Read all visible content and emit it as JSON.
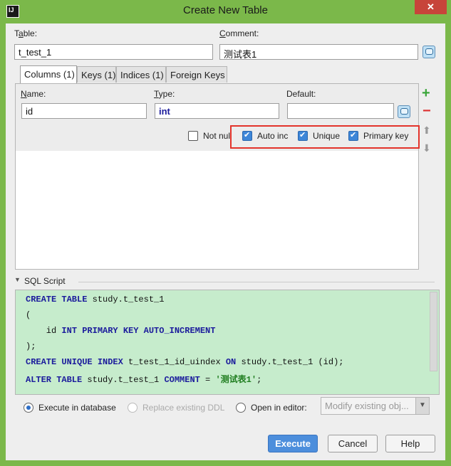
{
  "window": {
    "title": "Create New Table",
    "close": "✕"
  },
  "form": {
    "table_label": "Table:",
    "table_value": "t_test_1",
    "comment_label": "Comment:",
    "comment_value": "测试表1"
  },
  "tabs": [
    "Columns (1)",
    "Keys (1)",
    "Indices (1)",
    "Foreign Keys"
  ],
  "column": {
    "name_label": "Name:",
    "name_value": "id",
    "type_label": "Type:",
    "type_value": "int",
    "default_label": "Default:",
    "default_value": "",
    "not_null_label": "Not null",
    "not_null_checked": false,
    "auto_inc_label": "Auto inc",
    "auto_inc_checked": true,
    "unique_label": "Unique",
    "unique_checked": true,
    "primary_key_label": "Primary key",
    "primary_key_checked": true
  },
  "side_buttons": {
    "add": "+",
    "remove": "−",
    "up": "⬆",
    "down": "⬇"
  },
  "sql": {
    "header": "SQL Script",
    "lines": [
      "CREATE TABLE study.t_test_1",
      "(",
      "    id INT PRIMARY KEY AUTO_INCREMENT",
      ");",
      "CREATE UNIQUE INDEX t_test_1_id_uindex ON study.t_test_1 (id);",
      "ALTER TABLE study.t_test_1 COMMENT = '测试表1';"
    ]
  },
  "options": {
    "execute_db": "Execute in database",
    "replace_ddl": "Replace existing DDL",
    "open_editor": "Open in editor:",
    "open_editor_value": "Modify existing obj..."
  },
  "buttons": {
    "execute": "Execute",
    "cancel": "Cancel",
    "help": "Help"
  }
}
